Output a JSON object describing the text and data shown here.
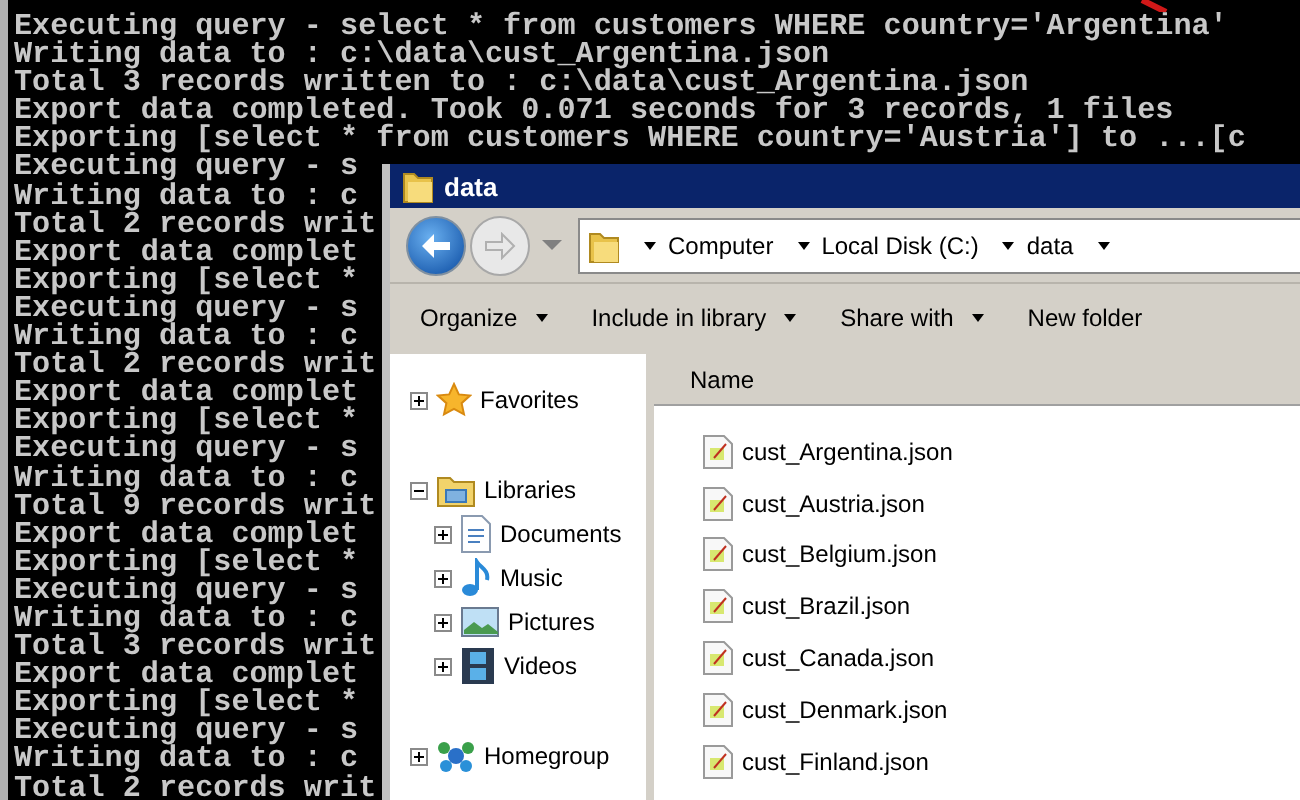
{
  "console": {
    "lines": [
      "Executing query - select * from customers WHERE country='Argentina'",
      "Writing data to : c:\\data\\cust_Argentina.json",
      "Total 3 records written to : c:\\data\\cust_Argentina.json",
      "Export data completed. Took 0.071 seconds for 3 records, 1 files",
      "Exporting [select * from customers WHERE country='Austria'] to ...[c",
      "Executing query - s",
      "Writing data to : c",
      "Total 2 records writ",
      "Export data complet",
      "Exporting [select *",
      "Executing query - s",
      "Writing data to : c",
      "Total 2 records writ",
      "Export data complet",
      "Exporting [select *",
      "Executing query - s",
      "Writing data to : c",
      "Total 9 records writ",
      "Export data complet",
      "Exporting [select *",
      "Executing query - s",
      "Writing data to : c",
      "Total 3 records writ",
      "Export data complet",
      "Exporting [select *",
      "Executing query - s",
      "Writing data to : c",
      "Total 2 records writ"
    ]
  },
  "explorer": {
    "title": "data",
    "address": [
      "Computer",
      "Local Disk (C:)",
      "data"
    ],
    "toolbar": [
      {
        "label": "Organize",
        "dropdown": true
      },
      {
        "label": "Include in library",
        "dropdown": true
      },
      {
        "label": "Share with",
        "dropdown": true
      },
      {
        "label": "New folder",
        "dropdown": false
      }
    ],
    "nav": [
      {
        "label": "Favorites",
        "kind": "favorites",
        "expanded": false
      },
      {
        "label": "Libraries",
        "kind": "libraries",
        "expanded": true,
        "children": [
          {
            "label": "Documents",
            "kind": "documents",
            "expanded": false
          },
          {
            "label": "Music",
            "kind": "music",
            "expanded": false
          },
          {
            "label": "Pictures",
            "kind": "pictures",
            "expanded": false
          },
          {
            "label": "Videos",
            "kind": "videos",
            "expanded": false
          }
        ]
      },
      {
        "label": "Homegroup",
        "kind": "homegroup",
        "expanded": false
      }
    ],
    "columns": [
      "Name"
    ],
    "files": [
      "cust_Argentina.json",
      "cust_Austria.json",
      "cust_Belgium.json",
      "cust_Brazil.json",
      "cust_Canada.json",
      "cust_Denmark.json",
      "cust_Finland.json"
    ]
  }
}
